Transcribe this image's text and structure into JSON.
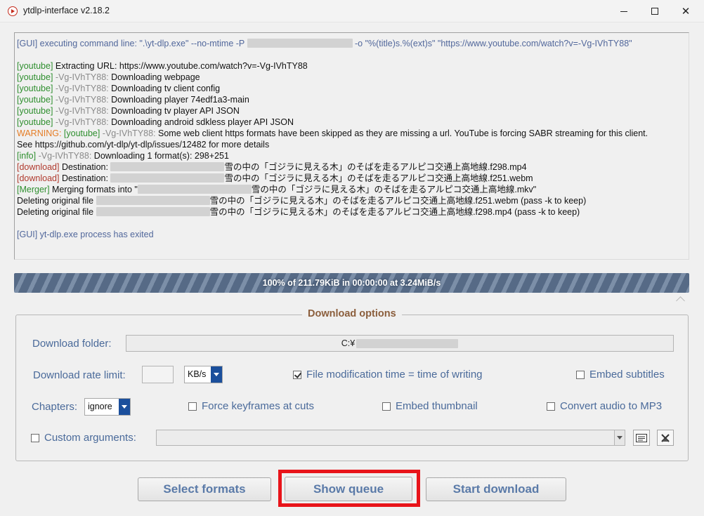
{
  "window": {
    "title": "ytdlp-interface v2.18.2",
    "controls": {
      "minimize": "minimize-icon",
      "maximize": "maximize-icon",
      "close": "✕"
    }
  },
  "log": {
    "line1": {
      "prefix": "[GUI]",
      "text": " executing command line: \".\\yt-dlp.exe\" --no-mtime  -P ",
      "text_after": " -o \"%(title)s.%(ext)s\" \"https://www.youtube.com/watch?v=-Vg-IVhTY88\""
    },
    "line2": {
      "tag": "[youtube]",
      "text": " Extracting URL: https://www.youtube.com/watch?v=-Vg-IVhTY88"
    },
    "line3": {
      "tag": "[youtube]",
      "id": " -Vg-IVhTY88:",
      "text": " Downloading webpage"
    },
    "line4": {
      "tag": "[youtube]",
      "id": " -Vg-IVhTY88:",
      "text": " Downloading tv client config"
    },
    "line5": {
      "tag": "[youtube]",
      "id": " -Vg-IVhTY88:",
      "text": " Downloading player 74edf1a3-main"
    },
    "line6": {
      "tag": "[youtube]",
      "id": " -Vg-IVhTY88:",
      "text": " Downloading tv player API JSON"
    },
    "line7": {
      "tag": "[youtube]",
      "id": " -Vg-IVhTY88:",
      "text": " Downloading android sdkless player API JSON"
    },
    "line8": {
      "warn": "WARNING:",
      "tag": " [youtube]",
      "id": " -Vg-IVhTY88:",
      "text": " Some web client https formats have been skipped as they are missing a url. YouTube is forcing SABR streaming for this client."
    },
    "line9": {
      "text": "See  https://github.com/yt-dlp/yt-dlp/issues/12482  for more details"
    },
    "line10": {
      "tag": "[info]",
      "id": " -Vg-IVhTY88:",
      "text": " Downloading 1 format(s): 298+251"
    },
    "line11": {
      "tag": "[download]",
      "text": " Destination: ",
      "text_after": "雪の中の「ゴジラに見える木」のそばを走るアルピコ交通上高地線.f298.mp4"
    },
    "line12": {
      "tag": "[download]",
      "text": " Destination: ",
      "text_after": "雪の中の「ゴジラに見える木」のそばを走るアルピコ交通上高地線.f251.webm"
    },
    "line13": {
      "tag": "[Merger]",
      "text": " Merging formats into \"",
      "text_after": "雪の中の「ゴジラに見える木」のそばを走るアルピコ交通上高地線.mkv\""
    },
    "line14": {
      "text": "Deleting original file ",
      "text_after": "雪の中の「ゴジラに見える木」のそばを走るアルピコ交通上高地線.f251.webm (pass -k to keep)"
    },
    "line15": {
      "text": "Deleting original file ",
      "text_after": "雪の中の「ゴジラに見える木」のそばを走るアルピコ交通上高地線.f298.mp4 (pass -k to keep)"
    },
    "line16": {
      "prefix": "[GUI]",
      "text": " yt-dlp.exe process has exited"
    }
  },
  "progress": {
    "text": "100% of  211.79KiB in 00:00:00 at 3.24MiB/s",
    "fraction": 1.0
  },
  "options": {
    "legend": "Download options",
    "folder_label": "Download folder:",
    "folder_value": "C:¥",
    "rate_label": "Download rate limit:",
    "rate_value": "",
    "rate_unit": "KB/s",
    "mtime_label": "File modification time = time of writing",
    "mtime_checked": true,
    "subs_label": "Embed subtitles",
    "subs_checked": false,
    "chapters_label": "Chapters:",
    "chapters_value": "ignore",
    "keyframes_label": "Force keyframes at cuts",
    "thumbnail_label": "Embed thumbnail",
    "mp3_label": "Convert audio to MP3",
    "custom_label": "Custom arguments:",
    "custom_value": ""
  },
  "buttons": {
    "select_formats": "Select formats",
    "show_queue": "Show queue",
    "start_download": "Start download"
  },
  "colors": {
    "highlight": "#e8141a",
    "label": "#4a6a9a",
    "legend": "#8b5e3c",
    "log_green": "#2f8f2f",
    "log_warning": "#e57c24",
    "log_download": "#b03a2e"
  }
}
